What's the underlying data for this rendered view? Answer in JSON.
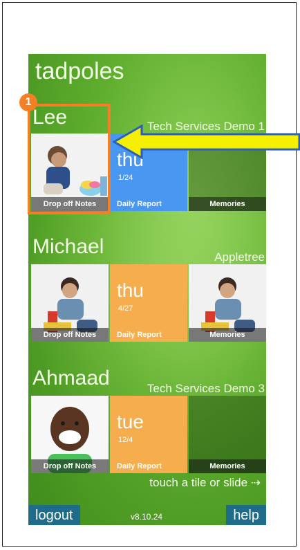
{
  "app": {
    "title": "tadpoles",
    "hint": "touch a tile or slide ⇢",
    "version": "v8.10.24",
    "logout_label": "logout",
    "help_label": "help"
  },
  "children": [
    {
      "name": "Lee",
      "org": "Tech Services Demo 1",
      "tiles": {
        "dropoff_label": "Drop off Notes",
        "report_day": "thu",
        "report_date": "1/24",
        "report_label": "Daily Report",
        "memories_label": "Memories"
      }
    },
    {
      "name": "Michael",
      "org": "Appletree",
      "tiles": {
        "dropoff_label": "Drop off Notes",
        "report_day": "thu",
        "report_date": "4/27",
        "report_label": "Daily Report",
        "memories_label": "Memories"
      }
    },
    {
      "name": "Ahmaad",
      "org": "Tech Services Demo 3",
      "tiles": {
        "dropoff_label": "Drop off Notes",
        "report_day": "tue",
        "report_date": "12/4",
        "report_label": "Daily Report",
        "memories_label": "Memories"
      }
    }
  ],
  "annotation": {
    "step_number": "1",
    "highlight_color": "#f47f25",
    "arrow_color": "#f5f000"
  },
  "colors": {
    "report_blue": "#4a97f2",
    "report_orange": "#f6ad4d",
    "button_blue": "#1f6b8a"
  }
}
